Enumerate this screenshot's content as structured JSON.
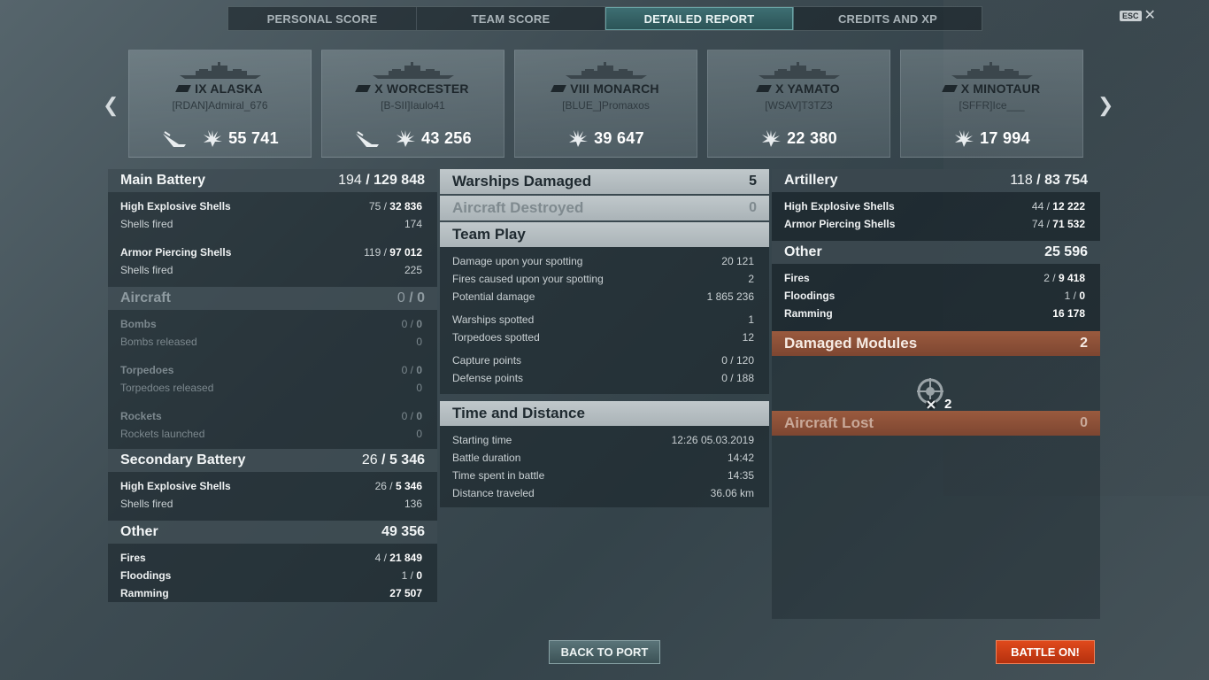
{
  "tabs": [
    "PERSONAL SCORE",
    "TEAM SCORE",
    "DETAILED REPORT",
    "CREDITS AND XP"
  ],
  "active_tab": "DETAILED REPORT",
  "esc_label": "ESC",
  "ships": [
    {
      "name": "IX ALASKA",
      "player": "[RDAN]Admiral_676",
      "damage": "55 741",
      "sunk_icon": true
    },
    {
      "name": "X WORCESTER",
      "player": "[B-SII]Iaulo41",
      "damage": "43 256",
      "sunk_icon": true
    },
    {
      "name": "VIII MONARCH",
      "player": "[BLUE_]Promaxos",
      "damage": "39 647",
      "sunk_icon": false
    },
    {
      "name": "X YAMATO",
      "player": "[WSAV]T3TZ3",
      "damage": "22 380",
      "sunk_icon": false
    },
    {
      "name": "X MINOTAUR",
      "player": "[SFFR]Ice___",
      "damage": "17 994",
      "sunk_icon": false
    }
  ],
  "left": {
    "main_battery": {
      "title": "Main Battery",
      "hits": "194",
      "damage": "129 848",
      "he_label": "High Explosive Shells",
      "he_hits": "75",
      "he_damage": "32 836",
      "he_fired_label": "Shells fired",
      "he_fired": "174",
      "ap_label": "Armor Piercing Shells",
      "ap_hits": "119",
      "ap_damage": "97 012",
      "ap_fired_label": "Shells fired",
      "ap_fired": "225"
    },
    "aircraft": {
      "title": "Aircraft",
      "hits": "0",
      "damage": "0",
      "bombs_label": "Bombs",
      "bombs_hits": "0",
      "bombs_damage": "0",
      "bombs_rel_label": "Bombs released",
      "bombs_rel": "0",
      "torp_label": "Torpedoes",
      "torp_hits": "0",
      "torp_damage": "0",
      "torp_rel_label": "Torpedoes released",
      "torp_rel": "0",
      "rock_label": "Rockets",
      "rock_hits": "0",
      "rock_damage": "0",
      "rock_rel_label": "Rockets launched",
      "rock_rel": "0"
    },
    "secondary": {
      "title": "Secondary Battery",
      "hits": "26",
      "damage": "5 346",
      "he_label": "High Explosive Shells",
      "he_hits": "26",
      "he_damage": "5 346",
      "fired_label": "Shells fired",
      "fired": "136"
    },
    "other": {
      "title": "Other",
      "damage": "49 356",
      "fires_label": "Fires",
      "fires_count": "4",
      "fires_damage": "21 849",
      "flood_label": "Floodings",
      "flood_count": "1",
      "flood_damage": "0",
      "ram_label": "Ramming",
      "ram_damage": "27 507"
    }
  },
  "middle": {
    "warships_damaged": {
      "title": "Warships Damaged",
      "value": "5"
    },
    "aircraft_destroyed": {
      "title": "Aircraft Destroyed",
      "value": "0"
    },
    "team_play": {
      "title": "Team Play",
      "rows1": [
        {
          "label": "Damage upon your spotting",
          "value": "20 121"
        },
        {
          "label": "Fires caused upon your spotting",
          "value": "2"
        },
        {
          "label": "Potential damage",
          "value": "1 865 236"
        }
      ],
      "rows2": [
        {
          "label": "Warships spotted",
          "value": "1"
        },
        {
          "label": "Torpedoes spotted",
          "value": "12"
        }
      ],
      "rows3": [
        {
          "label": "Capture points",
          "value": "0 / 120"
        },
        {
          "label": "Defense points",
          "value": "0 / 188"
        }
      ]
    },
    "time_distance": {
      "title": "Time and Distance",
      "rows": [
        {
          "label": "Starting time",
          "value": "12:26  05.03.2019"
        },
        {
          "label": "Battle duration",
          "value": "14:42"
        },
        {
          "label": "Time spent in battle",
          "value": "14:35"
        },
        {
          "label": "Distance traveled",
          "value": "36.06 km"
        }
      ]
    }
  },
  "right": {
    "artillery": {
      "title": "Artillery",
      "hits": "118",
      "damage": "83 754",
      "he_label": "High Explosive Shells",
      "he_hits": "44",
      "he_damage": "12 222",
      "ap_label": "Armor Piercing Shells",
      "ap_hits": "74",
      "ap_damage": "71 532"
    },
    "other": {
      "title": "Other",
      "damage": "25 596",
      "fires_label": "Fires",
      "fires_count": "2",
      "fires_damage": "9 418",
      "flood_label": "Floodings",
      "flood_count": "1",
      "flood_damage": "0",
      "ram_label": "Ramming",
      "ram_damage": "16 178"
    },
    "damaged_modules": {
      "title": "Damaged Modules",
      "value": "2",
      "module_count": "2"
    },
    "aircraft_lost": {
      "title": "Aircraft Lost",
      "value": "0"
    }
  },
  "buttons": {
    "back": "BACK TO PORT",
    "battle": "BATTLE ON!"
  },
  "colors": {
    "accent_tab": "#3e6f73",
    "battle_button": "#d0401a",
    "orange_header": "#8c5038"
  }
}
